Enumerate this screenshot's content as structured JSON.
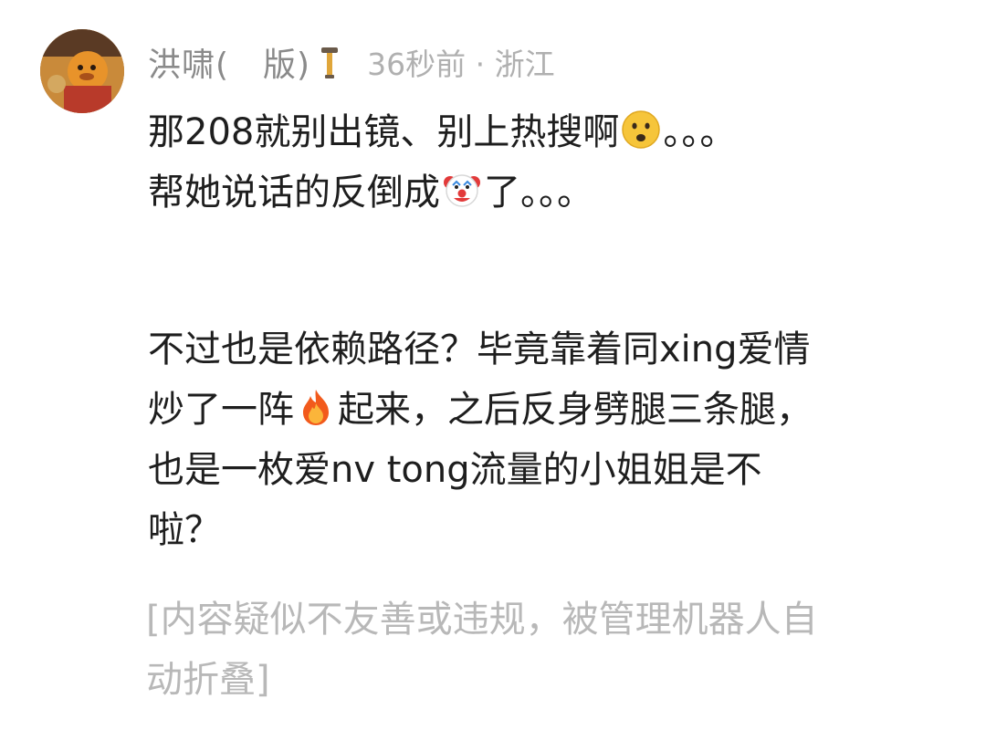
{
  "comment": {
    "username": "洪啸(　版)",
    "time": "36秒前",
    "separator": "·",
    "location": "浙江",
    "lines": {
      "l1_text": "那208就别出镜、别上热搜啊",
      "l1_tail": "。。。",
      "l2_text": "帮她说话的反倒成",
      "l2_tail": "了。。。",
      "l3": "不过也是依赖路径？毕竟靠着同xing爱情",
      "l4_text": "炒了一阵",
      "l4_tail": "起来，之后反身劈腿三条腿，",
      "l5": "也是一枚爱nv tong流量的小姐姐是不",
      "l6": "啦？"
    },
    "emojis": {
      "worried": "worried-face-icon",
      "clown": "clown-face-icon",
      "fire": "fire-icon"
    },
    "folded_notice": {
      "line1": "[内容疑似不友善或违规，被管理机器人自",
      "line2": "动折叠]"
    }
  }
}
